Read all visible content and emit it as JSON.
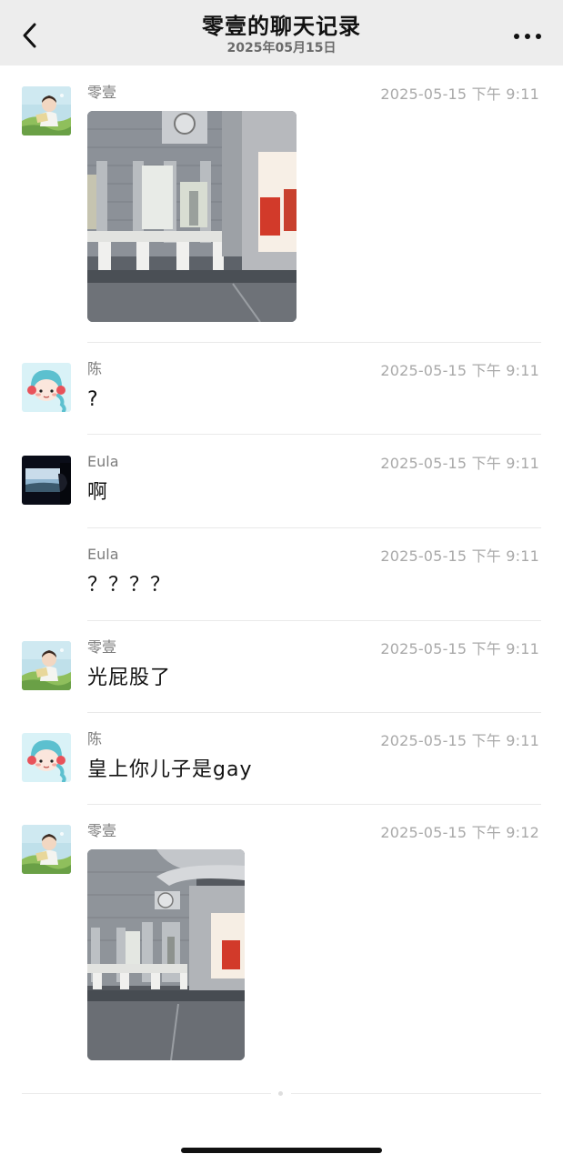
{
  "header": {
    "title": "零壹的聊天记录",
    "subtitle": "2025年05月15日"
  },
  "messages": [
    {
      "sender": "零壹",
      "time": "2025-05-15 下午 9:11",
      "type": "image"
    },
    {
      "sender": "陈",
      "time": "2025-05-15 下午 9:11",
      "text": "?"
    },
    {
      "sender": "Eula",
      "time": "2025-05-15 下午 9:11",
      "text": "啊"
    },
    {
      "sender": "Eula",
      "time": "2025-05-15 下午 9:11",
      "text": "？？？？"
    },
    {
      "sender": "零壹",
      "time": "2025-05-15 下午 9:11",
      "text": "光屁股了"
    },
    {
      "sender": "陈",
      "time": "2025-05-15 下午 9:11",
      "text": "皇上你儿子是gay"
    },
    {
      "sender": "零壹",
      "time": "2025-05-15 下午 9:12",
      "type": "image"
    }
  ],
  "colors": {
    "header_bg": "#ededed",
    "time_text": "#a9a9a9",
    "sender_text": "#7c7c7c",
    "chen_avatar_bg": "#d9f2f7",
    "poster_red": "#d23a2a"
  },
  "icons": [
    "back-chevron-icon",
    "more-dots-icon"
  ]
}
